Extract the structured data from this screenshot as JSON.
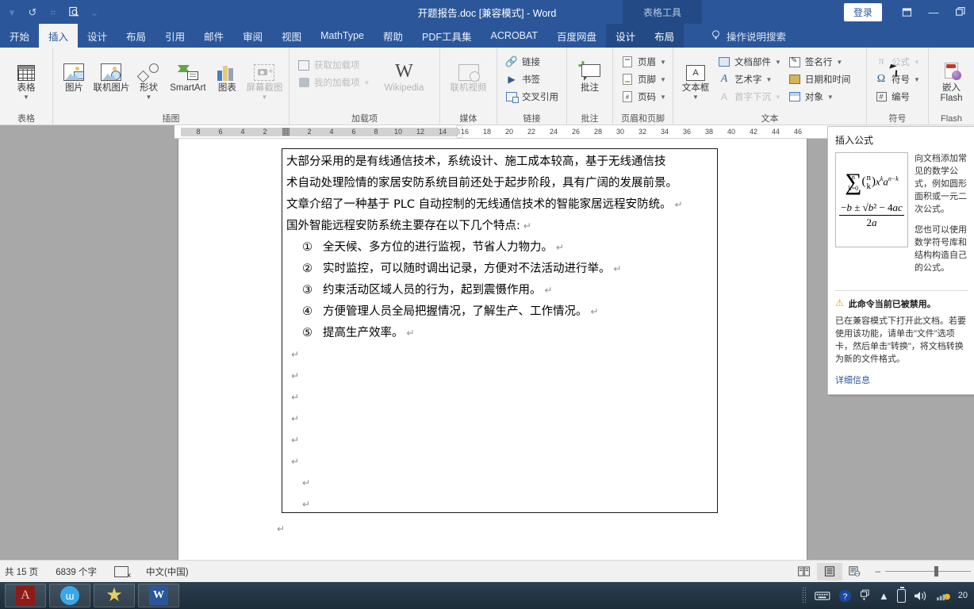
{
  "titlebar": {
    "document_title": "开题报告.doc [兼容模式]  -  Word",
    "context_tab_group": "表格工具",
    "signin_label": "登录",
    "quick_access": [
      {
        "name": "customize-qat",
        "glyph": "▾"
      },
      {
        "name": "undo",
        "glyph": "↺"
      },
      {
        "name": "repeat",
        "glyph": "⌗"
      },
      {
        "name": "print-preview",
        "glyph": "🔍"
      },
      {
        "name": "qat-dropdown",
        "glyph": "⌄"
      }
    ],
    "window_buttons": [
      {
        "name": "ribbon-display-options",
        "glyph": "▭"
      },
      {
        "name": "minimize",
        "glyph": "—"
      },
      {
        "name": "restore",
        "glyph": "❐"
      }
    ]
  },
  "ribbon_tabs": [
    {
      "label": "开始",
      "active": false,
      "context": false
    },
    {
      "label": "插入",
      "active": true,
      "context": false
    },
    {
      "label": "设计",
      "active": false,
      "context": false
    },
    {
      "label": "布局",
      "active": false,
      "context": false
    },
    {
      "label": "引用",
      "active": false,
      "context": false
    },
    {
      "label": "邮件",
      "active": false,
      "context": false
    },
    {
      "label": "审阅",
      "active": false,
      "context": false
    },
    {
      "label": "视图",
      "active": false,
      "context": false
    },
    {
      "label": "MathType",
      "active": false,
      "context": false
    },
    {
      "label": "帮助",
      "active": false,
      "context": false
    },
    {
      "label": "PDF工具集",
      "active": false,
      "context": false
    },
    {
      "label": "ACROBAT",
      "active": false,
      "context": false
    },
    {
      "label": "百度网盘",
      "active": false,
      "context": false
    },
    {
      "label": "设计",
      "active": false,
      "context": true
    },
    {
      "label": "布局",
      "active": false,
      "context": true
    }
  ],
  "tell_me": {
    "label": "操作说明搜索",
    "icon": "lightbulb-icon"
  },
  "ribbon_groups": [
    {
      "label": "表格",
      "big_buttons": [
        {
          "label": "表格",
          "icon": "table-icon",
          "has_caret": true,
          "disabled": false
        }
      ],
      "small_buttons": []
    },
    {
      "label": "插图",
      "big_buttons": [
        {
          "label": "图片",
          "icon": "picture-icon",
          "has_caret": false,
          "disabled": false
        },
        {
          "label": "联机图片",
          "icon": "online-picture-icon",
          "has_caret": false,
          "disabled": false
        },
        {
          "label": "形状",
          "icon": "shapes-icon",
          "has_caret": true,
          "disabled": false
        },
        {
          "label": "SmartArt",
          "icon": "smartart-icon",
          "has_caret": false,
          "disabled": false
        },
        {
          "label": "图表",
          "icon": "chart-icon",
          "has_caret": false,
          "disabled": false
        },
        {
          "label": "屏幕截图",
          "icon": "screenshot-icon",
          "has_caret": true,
          "disabled": true
        }
      ],
      "small_buttons": []
    },
    {
      "label": "加载项",
      "big_buttons": [
        {
          "label": "Wikipedia",
          "icon": "wikipedia-icon",
          "has_caret": false,
          "disabled": true
        }
      ],
      "small_buttons": [
        {
          "label": "获取加载项",
          "icon": "get-addins-icon",
          "has_caret": false,
          "disabled": true
        },
        {
          "label": "我的加载项",
          "icon": "my-addins-icon",
          "has_caret": true,
          "disabled": true
        }
      ]
    },
    {
      "label": "媒体",
      "big_buttons": [
        {
          "label": "联机视频",
          "icon": "online-video-icon",
          "has_caret": false,
          "disabled": true
        }
      ],
      "small_buttons": []
    },
    {
      "label": "链接",
      "big_buttons": [],
      "small_buttons": [
        {
          "label": "链接",
          "icon": "hyperlink-icon",
          "has_caret": false,
          "disabled": false
        },
        {
          "label": "书签",
          "icon": "bookmark-icon",
          "has_caret": false,
          "disabled": false
        },
        {
          "label": "交叉引用",
          "icon": "cross-reference-icon",
          "has_caret": false,
          "disabled": false
        }
      ]
    },
    {
      "label": "批注",
      "big_buttons": [
        {
          "label": "批注",
          "icon": "new-comment-icon",
          "has_caret": false,
          "disabled": false
        }
      ],
      "small_buttons": []
    },
    {
      "label": "页眉和页脚",
      "big_buttons": [],
      "small_buttons": [
        {
          "label": "页眉",
          "icon": "header-icon",
          "has_caret": true,
          "disabled": false
        },
        {
          "label": "页脚",
          "icon": "footer-icon",
          "has_caret": true,
          "disabled": false
        },
        {
          "label": "页码",
          "icon": "page-number-icon",
          "has_caret": true,
          "disabled": false
        }
      ]
    },
    {
      "label": "文本",
      "big_buttons": [
        {
          "label": "文本框",
          "icon": "text-box-icon",
          "has_caret": true,
          "disabled": false
        }
      ],
      "small_buttons": [
        {
          "label": "文档部件",
          "icon": "quick-parts-icon",
          "has_caret": true,
          "disabled": false
        },
        {
          "label": "艺术字",
          "icon": "wordart-icon",
          "has_caret": true,
          "disabled": false
        },
        {
          "label": "首字下沉",
          "icon": "drop-cap-icon",
          "has_caret": true,
          "disabled": true
        },
        {
          "label": "签名行",
          "icon": "signature-line-icon",
          "has_caret": true,
          "disabled": false
        },
        {
          "label": "日期和时间",
          "icon": "date-time-icon",
          "has_caret": false,
          "disabled": false
        },
        {
          "label": "对象",
          "icon": "object-icon",
          "has_caret": true,
          "disabled": false
        }
      ]
    },
    {
      "label": "符号",
      "big_buttons": [],
      "small_buttons": [
        {
          "label": "公式",
          "icon": "equation-icon",
          "has_caret": true,
          "disabled": true
        },
        {
          "label": "符号",
          "icon": "symbol-icon",
          "has_caret": true,
          "disabled": false
        },
        {
          "label": "编号",
          "icon": "number-icon",
          "has_caret": false,
          "disabled": false
        }
      ]
    },
    {
      "label": "Flash",
      "big_buttons": [
        {
          "label": "嵌入\nFlash",
          "icon": "embed-flash-icon",
          "has_caret": false,
          "disabled": false
        }
      ],
      "small_buttons": []
    }
  ],
  "ruler": {
    "left_numbers": [
      "8",
      "6",
      "4",
      "2"
    ],
    "right_numbers": [
      "2",
      "4",
      "6",
      "8",
      "10",
      "12",
      "14",
      "16",
      "18",
      "20",
      "22",
      "24",
      "26",
      "28",
      "30",
      "32",
      "34",
      "36",
      "38",
      "40",
      "42",
      "44",
      "46"
    ]
  },
  "document": {
    "paragraphs": [
      "大部分采用的是有线通信技术，系统设计、施工成本较高，基于无线通信技",
      "术自动处理险情的家居安防系统目前还处于起步阶段，具有广阔的发展前景。",
      "文章介绍了一种基于 PLC 自动控制的无线通信技术的智能家居远程安防统。",
      "国外智能远程安防系统主要存在以下几个特点:"
    ],
    "list_items": [
      {
        "marker": "①",
        "text": "全天候、多方位的进行监视，节省人力物力。"
      },
      {
        "marker": "②",
        "text": "实时监控，可以随时调出记录，方便对不法活动进行举。"
      },
      {
        "marker": "③",
        "text": "约束活动区域人员的行为，起到震慑作用。"
      },
      {
        "marker": "④",
        "text": "方便管理人员全局把握情况，了解生产、工作情况。"
      },
      {
        "marker": "⑤",
        "text": "提高生产效率。"
      }
    ],
    "pilcrow": "↵",
    "empty_paragraph_count": 8
  },
  "screentip": {
    "title": "插入公式",
    "preview_equation_top": "∑(n k) x^k a^(n−k)",
    "preview_equation_bottom_num": "−b ± √(b² − 4ac)",
    "preview_equation_bottom_den": "2a",
    "description_1": "向文档添加常见的数学公式，例如圆形面积或一元二次公式。",
    "description_2": "您也可以使用数学符号库和结构构造自己的公式。",
    "warning_title": "此命令当前已被禁用。",
    "warning_body": "已在兼容模式下打开此文档。若要使用该功能，请单击\"文件\"选项卡，然后单击\"转换\"，将文档转换为新的文件格式。",
    "more_info_link": "详细信息",
    "warning_icon": "warning-triangle-icon"
  },
  "statusbar": {
    "page_count": "共 15 页",
    "word_count": "6839 个字",
    "proofing_icon": "proofing-errors-icon",
    "language": "中文(中国)",
    "view_buttons": [
      {
        "name": "read-mode-view",
        "glyph": "▥",
        "active": false
      },
      {
        "name": "print-layout-view",
        "glyph": "▤",
        "active": true
      },
      {
        "name": "web-layout-view",
        "glyph": "▨",
        "active": false
      }
    ],
    "zoom_out": "–",
    "zoom_in": "+"
  },
  "taskbar": {
    "apps": [
      {
        "name": "taskbar-app-acrobat",
        "label": "A"
      },
      {
        "name": "taskbar-app-browser",
        "label": "m"
      },
      {
        "name": "taskbar-app-star",
        "label": "★"
      },
      {
        "name": "taskbar-app-word",
        "label": "W"
      }
    ],
    "tray": [
      {
        "name": "keyboard-icon",
        "glyph": "⌨"
      },
      {
        "name": "help-icon",
        "glyph": "?"
      },
      {
        "name": "window-switch-icon",
        "glyph": "❐"
      },
      {
        "name": "show-hidden-icons-icon",
        "glyph": "▲"
      },
      {
        "name": "battery-icon",
        "glyph": "▯"
      },
      {
        "name": "volume-icon",
        "glyph": "🔊"
      },
      {
        "name": "network-icon",
        "glyph": "📶"
      }
    ],
    "clock_partial": "20"
  },
  "colors": {
    "word_blue": "#2b579a",
    "context_tab_blue": "#234a85",
    "ribbon_bg": "#f3f3f3",
    "page_bg": "#a8a8a8",
    "taskbar": "#243645"
  }
}
